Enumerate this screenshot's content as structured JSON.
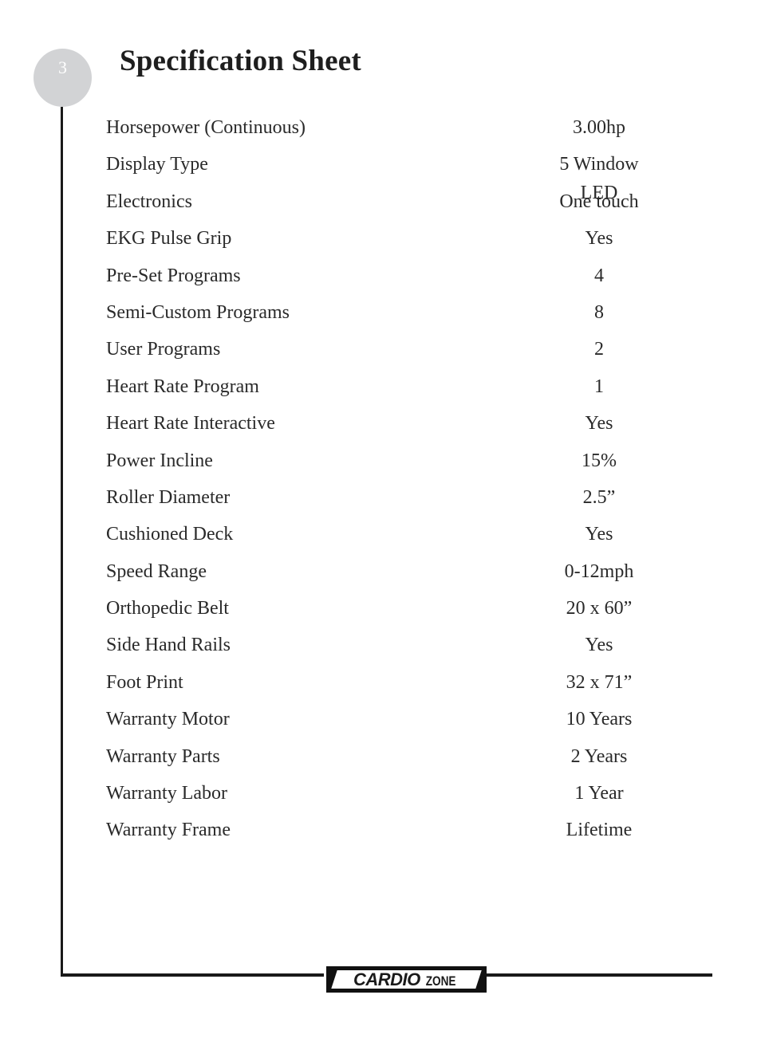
{
  "page_number": "3",
  "title": "Specification Sheet",
  "specs": [
    {
      "label": "Horsepower (Continuous)",
      "value": "3.00hp"
    },
    {
      "label": "Display Type",
      "value": "5 Window LED"
    },
    {
      "label": "Electronics",
      "value": "One touch"
    },
    {
      "label": "EKG Pulse Grip",
      "value": "Yes"
    },
    {
      "label": "Pre-Set Programs",
      "value": "4"
    },
    {
      "label": "Semi-Custom Programs",
      "value": "8"
    },
    {
      "label": "User Programs",
      "value": "2"
    },
    {
      "label": "Heart Rate Program",
      "value": "1"
    },
    {
      "label": "Heart Rate Interactive",
      "value": "Yes"
    },
    {
      "label": "Power Incline",
      "value": "15%"
    },
    {
      "label": "Roller Diameter",
      "value": "2.5”"
    },
    {
      "label": "Cushioned Deck",
      "value": "Yes"
    },
    {
      "label": "Speed Range",
      "value": "0-12mph"
    },
    {
      "label": "Orthopedic Belt",
      "value": "20 x 60”"
    },
    {
      "label": "Side Hand Rails",
      "value": "Yes"
    },
    {
      "label": "Foot Print",
      "value": "32 x 71”"
    },
    {
      "label": "Warranty Motor",
      "value": "10 Years"
    },
    {
      "label": "Warranty Parts",
      "value": "2 Years"
    },
    {
      "label": "Warranty Labor",
      "value": "1 Year"
    },
    {
      "label": "Warranty Frame",
      "value": "Lifetime"
    }
  ],
  "footer": {
    "logo_part1": "CARDIO",
    "logo_part2": "ZONE"
  }
}
